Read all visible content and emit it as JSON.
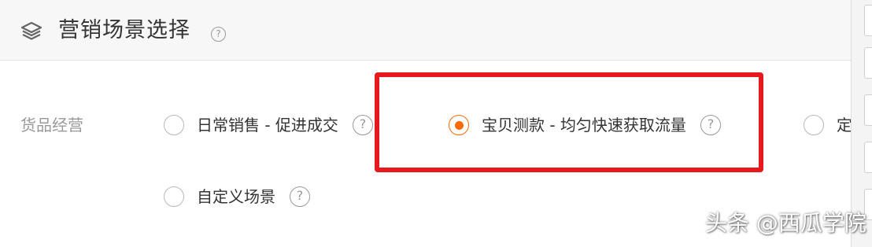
{
  "section": {
    "title": "营销场景选择",
    "icon": "layers-icon",
    "help": "?"
  },
  "goods": {
    "label": "货品经营",
    "options": [
      {
        "label": "日常销售 - 促进成交",
        "selected": false,
        "help": "?"
      },
      {
        "label": "宝贝测款 - 均匀快速获取流量",
        "selected": true,
        "help": "?"
      },
      {
        "label": "定",
        "selected": false
      },
      {
        "label": "自定义场景",
        "selected": false,
        "help": "?"
      }
    ]
  },
  "colors": {
    "accent": "#ff6a00",
    "highlight": "#e8191c"
  },
  "watermark": "头条 @西瓜学院"
}
